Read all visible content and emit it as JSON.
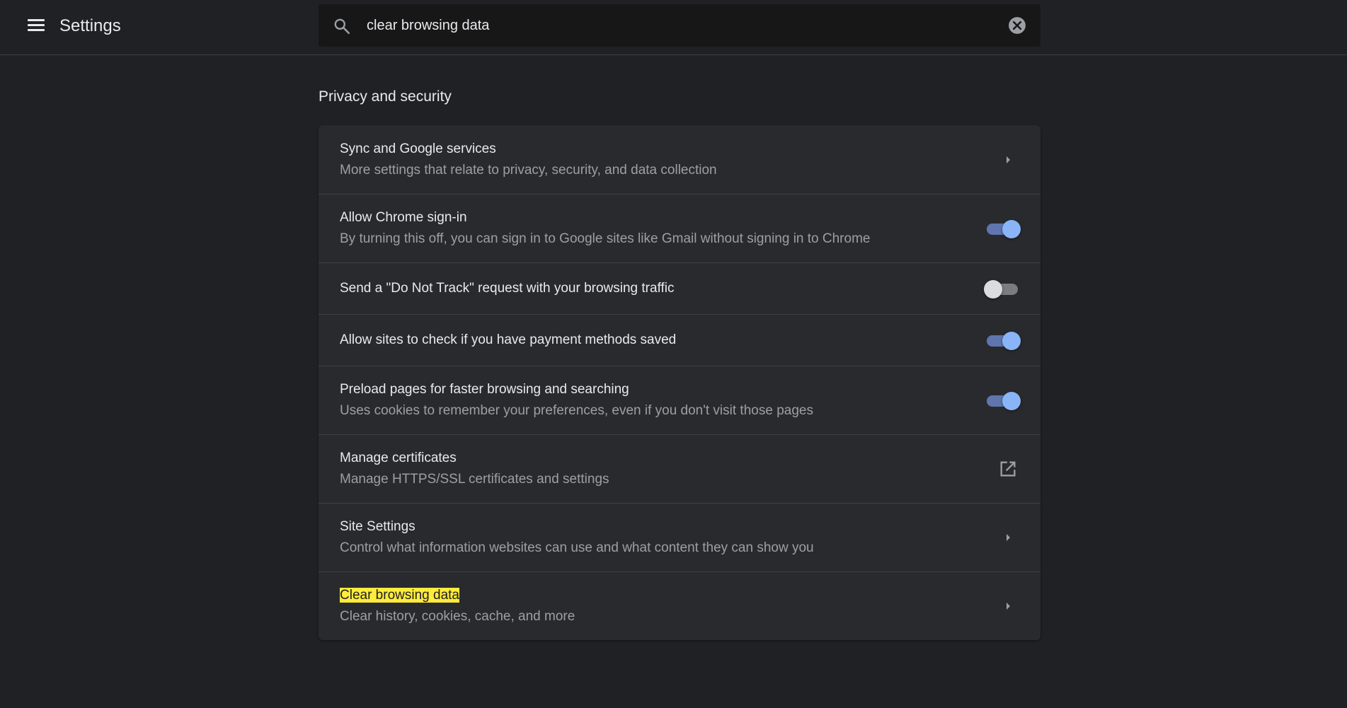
{
  "header": {
    "title": "Settings",
    "menu_icon": "hamburger-menu-icon"
  },
  "search": {
    "value": "clear browsing data",
    "icon": "search-icon",
    "clear_icon": "close-circle-icon"
  },
  "section": {
    "title": "Privacy and security"
  },
  "rows": [
    {
      "title": "Sync and Google services",
      "subtitle": "More settings that relate to privacy, security, and data collection",
      "control": "chevron"
    },
    {
      "title": "Allow Chrome sign-in",
      "subtitle": "By turning this off, you can sign in to Google sites like Gmail without signing in to Chrome",
      "control": "toggle",
      "enabled": true
    },
    {
      "title": "Send a \"Do Not Track\" request with your browsing traffic",
      "control": "toggle",
      "enabled": false
    },
    {
      "title": "Allow sites to check if you have payment methods saved",
      "control": "toggle",
      "enabled": true
    },
    {
      "title": "Preload pages for faster browsing and searching",
      "subtitle": "Uses cookies to remember your preferences, even if you don't visit those pages",
      "control": "toggle",
      "enabled": true
    },
    {
      "title": "Manage certificates",
      "subtitle": "Manage HTTPS/SSL certificates and settings",
      "control": "external-link"
    },
    {
      "title": "Site Settings",
      "subtitle": "Control what information websites can use and what content they can show you",
      "control": "chevron"
    },
    {
      "title": "Clear browsing data",
      "subtitle": "Clear history, cookies, cache, and more",
      "control": "chevron",
      "highlighted": true
    }
  ],
  "colors": {
    "background": "#202124",
    "card": "#292a2d",
    "accent": "#8ab4f8",
    "highlight": "#ffeb3b"
  }
}
